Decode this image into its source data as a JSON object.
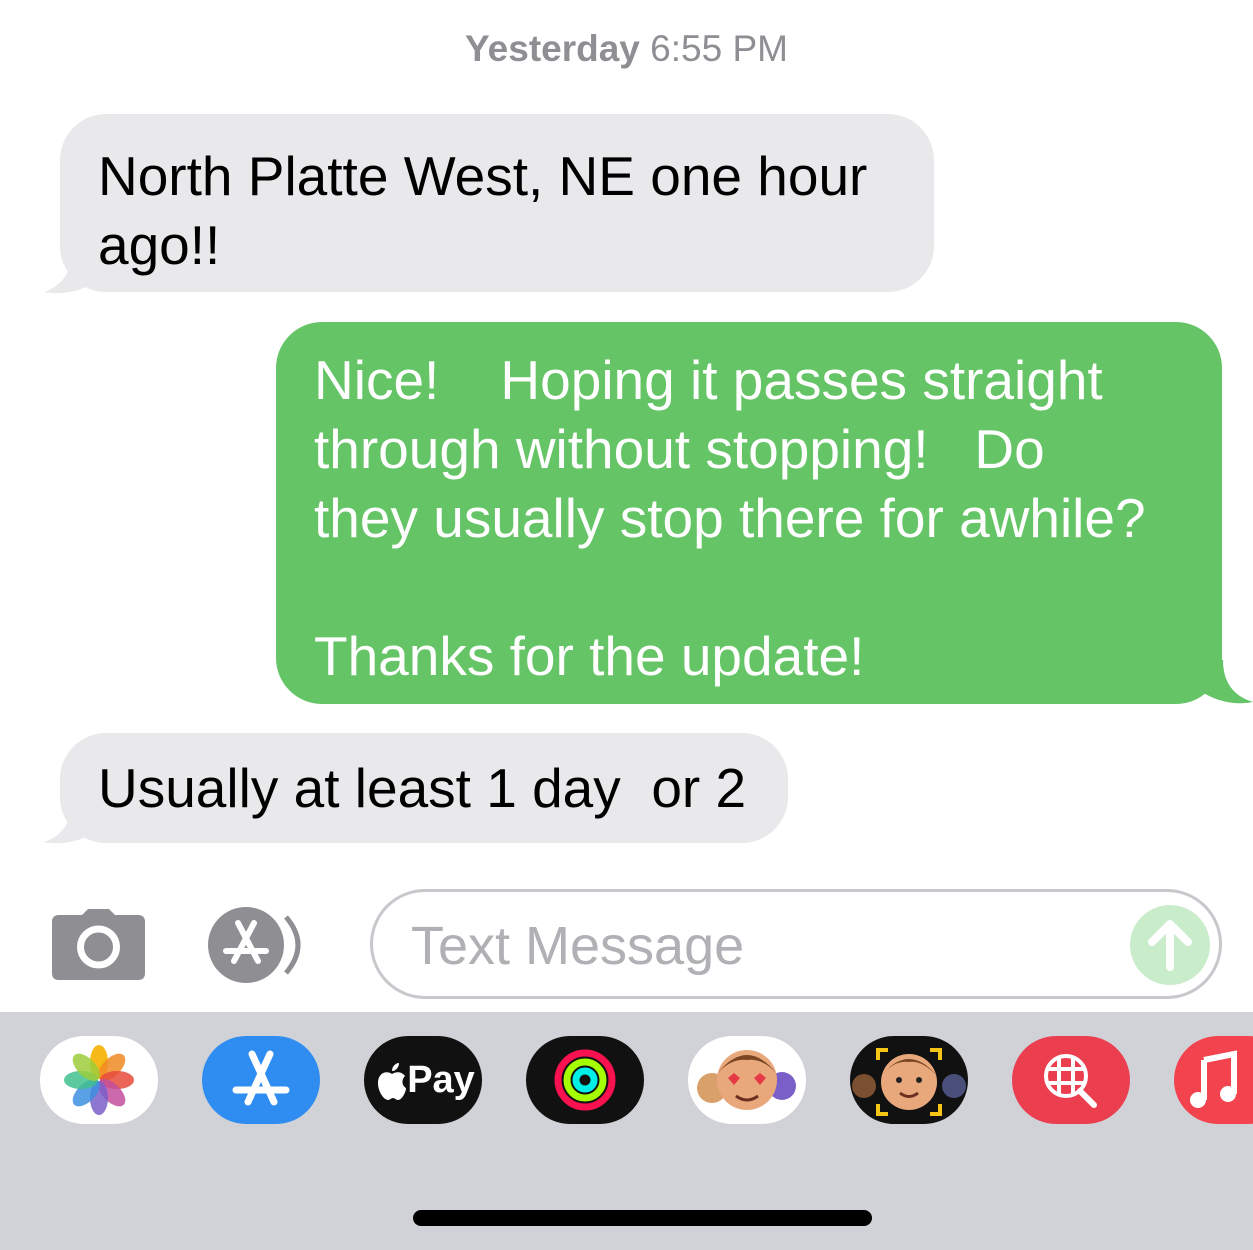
{
  "conversation": {
    "timestamp_day": "Yesterday",
    "timestamp_time": "6:55 PM",
    "messages": [
      {
        "direction": "incoming",
        "text": "North Platte West, NE one hour\nago!!"
      },
      {
        "direction": "outgoing",
        "text": "Nice!    Hoping it passes straight\nthrough without stopping!   Do\nthey usually stop there for awhile?\n\nThanks for the update!"
      },
      {
        "direction": "incoming",
        "text": "Usually at least 1 day  or 2"
      }
    ]
  },
  "composer": {
    "placeholder": "Text Message",
    "value": "",
    "camera_icon": "camera-icon",
    "apps_icon": "app-store-icon",
    "send_icon": "arrow-up-icon"
  },
  "app_drawer": {
    "apps": [
      {
        "name": "photos",
        "icon": "photos-icon"
      },
      {
        "name": "app-store",
        "icon": "app-store-icon"
      },
      {
        "name": "apple-pay",
        "icon": "apple-logo-icon",
        "label": "Pay"
      },
      {
        "name": "activity",
        "icon": "activity-rings-icon"
      },
      {
        "name": "memoji-stickers",
        "icon": "memoji-stickers-icon"
      },
      {
        "name": "memoji",
        "icon": "memoji-face-icon"
      },
      {
        "name": "images-search",
        "icon": "globe-search-icon"
      },
      {
        "name": "music",
        "icon": "music-note-icon"
      }
    ]
  },
  "colors": {
    "outgoing_bubble": "#65c466",
    "incoming_bubble": "#e9e9eb",
    "timestamp": "#8e8e93",
    "drawer_background": "#d1d2d8",
    "app_store_blue": "#2f8cf0",
    "images_red": "#eb3f4f",
    "music_red": "#f2434e"
  }
}
